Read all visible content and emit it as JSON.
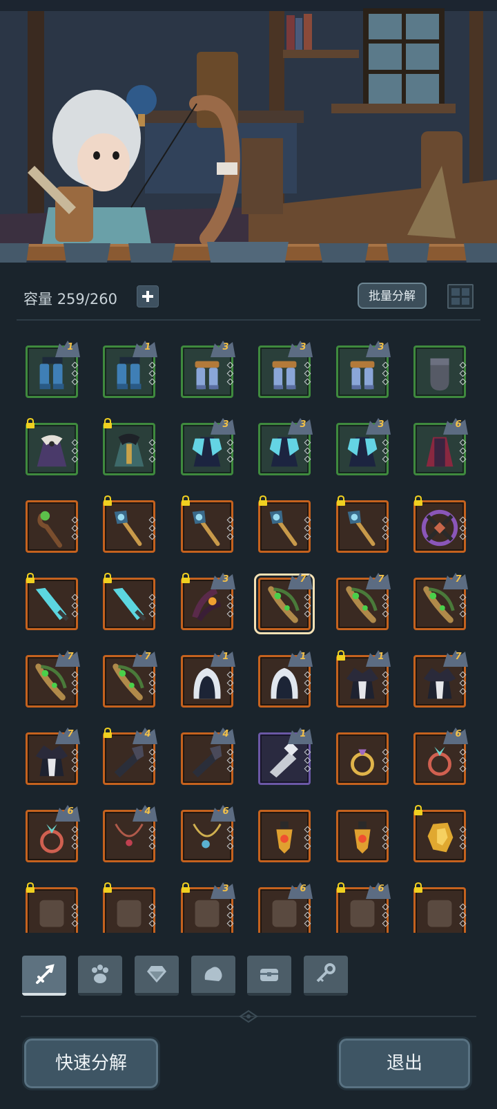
{
  "inventory": {
    "capacity_label": "容量",
    "capacity_value": "259/260",
    "batch_decompose_label": "批量分解"
  },
  "items": [
    {
      "row": 0,
      "rarity": "green",
      "art": "boots-blue",
      "level": "1",
      "locked": false,
      "selected": false
    },
    {
      "row": 0,
      "rarity": "green",
      "art": "boots-blue",
      "level": "1",
      "locked": false,
      "selected": false
    },
    {
      "row": 0,
      "rarity": "green",
      "art": "boots-armored",
      "level": "3",
      "locked": false,
      "selected": false
    },
    {
      "row": 0,
      "rarity": "green",
      "art": "boots-armored",
      "level": "3",
      "locked": false,
      "selected": false
    },
    {
      "row": 0,
      "rarity": "green",
      "art": "boots-armored",
      "level": "3",
      "locked": false,
      "selected": false
    },
    {
      "row": 0,
      "rarity": "green",
      "art": "sock-grey",
      "level": "",
      "locked": false,
      "selected": false
    },
    {
      "row": 1,
      "rarity": "green",
      "art": "robe-purple",
      "level": "",
      "locked": true,
      "selected": false
    },
    {
      "row": 1,
      "rarity": "green",
      "art": "robe-teal",
      "level": "",
      "locked": true,
      "selected": false
    },
    {
      "row": 1,
      "rarity": "green",
      "art": "cape-cyan",
      "level": "3",
      "locked": false,
      "selected": false
    },
    {
      "row": 1,
      "rarity": "green",
      "art": "cape-cyan",
      "level": "3",
      "locked": false,
      "selected": false
    },
    {
      "row": 1,
      "rarity": "green",
      "art": "cape-cyan",
      "level": "3",
      "locked": false,
      "selected": false
    },
    {
      "row": 1,
      "rarity": "green",
      "art": "cape-red",
      "level": "6",
      "locked": false,
      "selected": false
    },
    {
      "row": 2,
      "rarity": "orange",
      "art": "staff-wood",
      "level": "",
      "locked": false,
      "selected": false
    },
    {
      "row": 2,
      "rarity": "orange",
      "art": "scepter",
      "level": "",
      "locked": true,
      "selected": false
    },
    {
      "row": 2,
      "rarity": "orange",
      "art": "scepter",
      "level": "",
      "locked": true,
      "selected": false
    },
    {
      "row": 2,
      "rarity": "orange",
      "art": "scepter",
      "level": "",
      "locked": true,
      "selected": false
    },
    {
      "row": 2,
      "rarity": "orange",
      "art": "scepter",
      "level": "",
      "locked": true,
      "selected": false
    },
    {
      "row": 2,
      "rarity": "orange",
      "art": "cross-wheel",
      "level": "",
      "locked": true,
      "selected": false
    },
    {
      "row": 3,
      "rarity": "orange",
      "art": "sword-cyan",
      "level": "",
      "locked": true,
      "selected": false
    },
    {
      "row": 3,
      "rarity": "orange",
      "art": "sword-cyan",
      "level": "",
      "locked": true,
      "selected": false
    },
    {
      "row": 3,
      "rarity": "orange",
      "art": "claw-dark",
      "level": "3",
      "locked": true,
      "selected": false
    },
    {
      "row": 3,
      "rarity": "orange",
      "art": "bow-green",
      "level": "7",
      "locked": false,
      "selected": true
    },
    {
      "row": 3,
      "rarity": "orange",
      "art": "bow-green",
      "level": "7",
      "locked": false,
      "selected": false
    },
    {
      "row": 3,
      "rarity": "orange",
      "art": "bow-green",
      "level": "7",
      "locked": false,
      "selected": false
    },
    {
      "row": 4,
      "rarity": "orange",
      "art": "bow-green",
      "level": "7",
      "locked": false,
      "selected": false
    },
    {
      "row": 4,
      "rarity": "orange",
      "art": "bow-green",
      "level": "7",
      "locked": false,
      "selected": false
    },
    {
      "row": 4,
      "rarity": "orange",
      "art": "hood-white",
      "level": "1",
      "locked": false,
      "selected": false
    },
    {
      "row": 4,
      "rarity": "orange",
      "art": "hood-white",
      "level": "1",
      "locked": false,
      "selected": false
    },
    {
      "row": 4,
      "rarity": "orange",
      "art": "cloak-feather",
      "level": "1",
      "locked": true,
      "selected": false
    },
    {
      "row": 4,
      "rarity": "orange",
      "art": "cloak-feather",
      "level": "7",
      "locked": false,
      "selected": false
    },
    {
      "row": 5,
      "rarity": "orange",
      "art": "cloak-feather",
      "level": "7",
      "locked": false,
      "selected": false
    },
    {
      "row": 5,
      "rarity": "orange",
      "art": "bracer-dark",
      "level": "4",
      "locked": true,
      "selected": false
    },
    {
      "row": 5,
      "rarity": "orange",
      "art": "bracer-dark",
      "level": "4",
      "locked": false,
      "selected": false
    },
    {
      "row": 5,
      "rarity": "purple",
      "art": "bracer-silver",
      "level": "1",
      "locked": false,
      "selected": false
    },
    {
      "row": 5,
      "rarity": "orange",
      "art": "ring-gold",
      "level": "",
      "locked": false,
      "selected": false
    },
    {
      "row": 5,
      "rarity": "orange",
      "art": "ring-red",
      "level": "6",
      "locked": false,
      "selected": false
    },
    {
      "row": 6,
      "rarity": "orange",
      "art": "ring-red",
      "level": "6",
      "locked": false,
      "selected": false
    },
    {
      "row": 6,
      "rarity": "orange",
      "art": "necklace-red",
      "level": "4",
      "locked": false,
      "selected": false
    },
    {
      "row": 6,
      "rarity": "orange",
      "art": "necklace-blue",
      "level": "6",
      "locked": false,
      "selected": false
    },
    {
      "row": 6,
      "rarity": "orange",
      "art": "amulet-gold",
      "level": "",
      "locked": false,
      "selected": false
    },
    {
      "row": 6,
      "rarity": "orange",
      "art": "amulet-gold",
      "level": "",
      "locked": false,
      "selected": false
    },
    {
      "row": 6,
      "rarity": "orange",
      "art": "gem-gold",
      "level": "",
      "locked": true,
      "selected": false
    },
    {
      "row": 7,
      "rarity": "orange",
      "art": "partial",
      "level": "",
      "locked": true,
      "selected": false
    },
    {
      "row": 7,
      "rarity": "orange",
      "art": "partial",
      "level": "",
      "locked": true,
      "selected": false
    },
    {
      "row": 7,
      "rarity": "orange",
      "art": "partial",
      "level": "3",
      "locked": true,
      "selected": false
    },
    {
      "row": 7,
      "rarity": "orange",
      "art": "partial",
      "level": "6",
      "locked": false,
      "selected": false
    },
    {
      "row": 7,
      "rarity": "orange",
      "art": "partial",
      "level": "6",
      "locked": true,
      "selected": false
    },
    {
      "row": 7,
      "rarity": "orange",
      "art": "partial",
      "level": "",
      "locked": true,
      "selected": false
    }
  ],
  "tabs": [
    {
      "name": "tab-equipment",
      "icon": "sword-icon",
      "active": true
    },
    {
      "name": "tab-pets",
      "icon": "paw-icon",
      "active": false
    },
    {
      "name": "tab-gems",
      "icon": "diamond-icon",
      "active": false
    },
    {
      "name": "tab-materials",
      "icon": "ore-icon",
      "active": false
    },
    {
      "name": "tab-chests",
      "icon": "chest-icon",
      "active": false
    },
    {
      "name": "tab-keys",
      "icon": "key-icon",
      "active": false
    }
  ],
  "footer": {
    "quick_decompose_label": "快速分解",
    "exit_label": "退出"
  },
  "colors": {
    "green_rarity": "#3f8a3e",
    "orange_rarity": "#c5621e",
    "purple_rarity": "#6b58a6",
    "level_text": "#f1c04a",
    "background": "#1a242c"
  }
}
